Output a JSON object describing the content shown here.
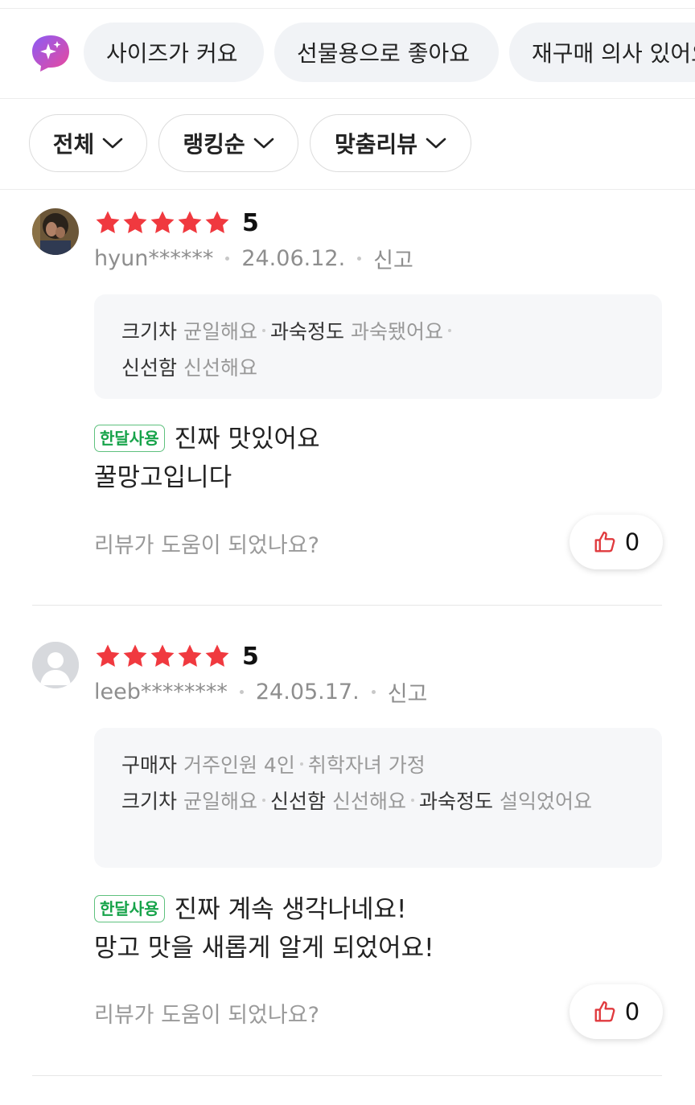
{
  "keyword_chips": [
    {
      "label": "사이즈가 커요"
    },
    {
      "label": "선물용으로 좋아요"
    },
    {
      "label": "재구매 의사 있어요"
    }
  ],
  "filters": [
    {
      "label": "전체"
    },
    {
      "label": "랭킹순"
    },
    {
      "label": "맞춤리뷰"
    }
  ],
  "reviews": [
    {
      "rating": "5",
      "stars_filled": 5,
      "user": "hyun******",
      "date": "24.06.12.",
      "report": "신고",
      "attributes": [
        {
          "key": "크기차",
          "value": "균일해요"
        },
        {
          "key": "과숙정도",
          "value": "과숙됐어요"
        },
        {
          "key": "신선함",
          "value": "신선해요"
        }
      ],
      "badge": "한달사용",
      "text_line1": "진짜 맛있어요",
      "text_line2": "꿀망고입니다",
      "helpful_prompt": "리뷰가 도움이 되었나요?",
      "likes": "0"
    },
    {
      "rating": "5",
      "stars_filled": 5,
      "user": "leeb********",
      "date": "24.05.17.",
      "report": "신고",
      "buyer_label": "구매자",
      "buyer_info1": "거주인원 4인",
      "buyer_info2": "취학자녀 가정",
      "attributes": [
        {
          "key": "크기차",
          "value": "균일해요"
        },
        {
          "key": "신선함",
          "value": "신선해요"
        },
        {
          "key": "과숙정도",
          "value": "설익었어요"
        }
      ],
      "badge": "한달사용",
      "text_line1": "진짜 계속 생각나네요!",
      "text_line2": "망고 맛을 새롭게 알게 되었어요!",
      "helpful_prompt": "리뷰가 도움이 되었나요?",
      "likes": "0"
    }
  ],
  "colors": {
    "star": "#f0393f",
    "badge_green": "#17a34a",
    "like_icon": "#e03a3e",
    "chip_bg": "#f1f3f6"
  },
  "icons": {
    "ai": "sparkle-chat-icon",
    "dropdown": "chevron-down-icon",
    "star": "star-icon",
    "like": "thumbs-up-icon"
  }
}
